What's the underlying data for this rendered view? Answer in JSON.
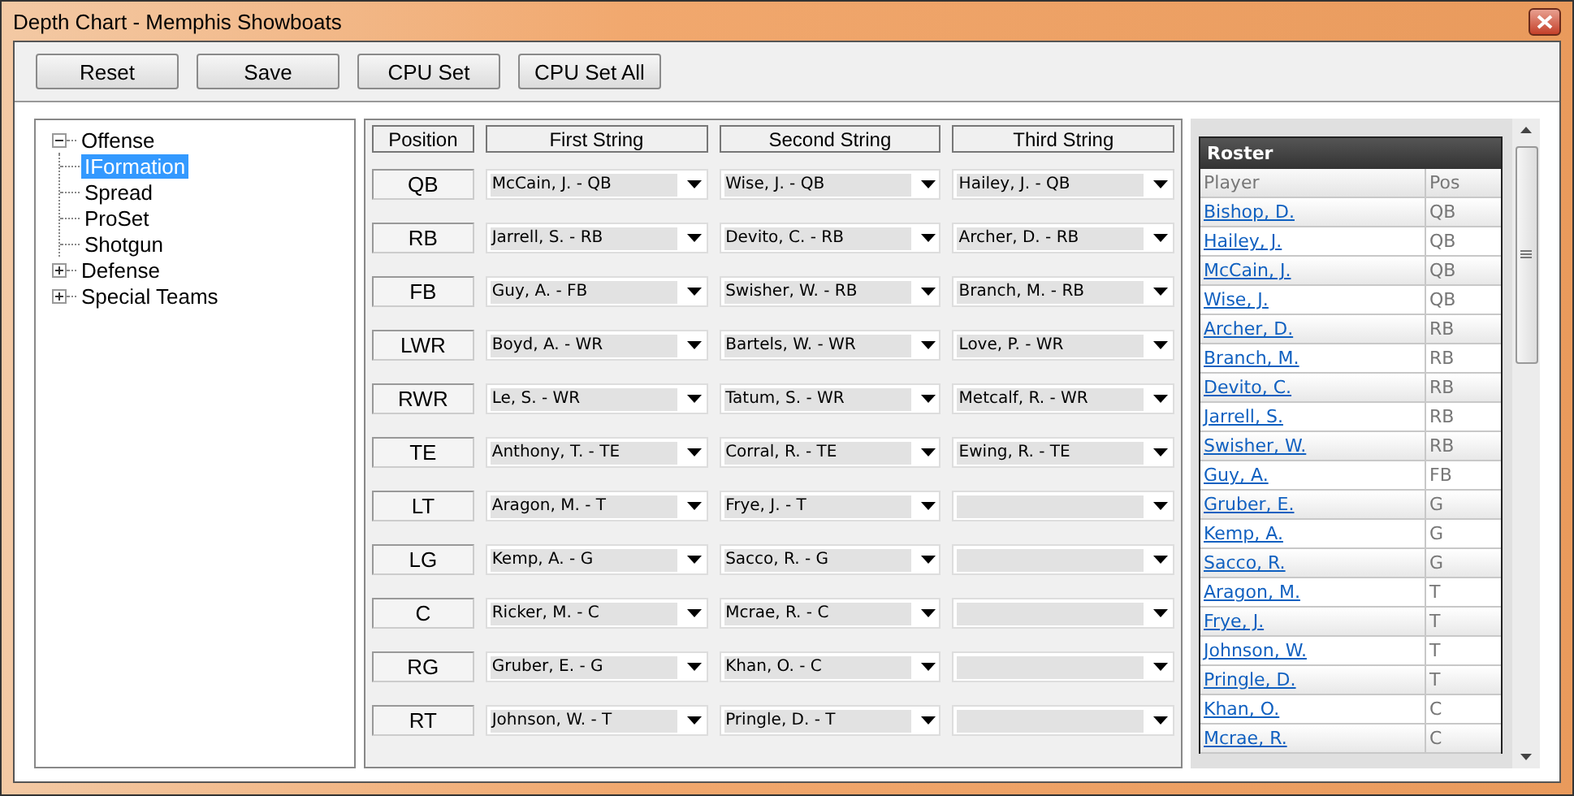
{
  "window": {
    "title": "Depth Chart - Memphis Showboats"
  },
  "toolbar": {
    "buttons": [
      "Reset",
      "Save",
      "CPU Set",
      "CPU Set All"
    ]
  },
  "tree": [
    {
      "label": "Offense",
      "expanded": true,
      "selected": false,
      "children": [
        {
          "label": "IFormation",
          "selected": true
        },
        {
          "label": "Spread",
          "selected": false
        },
        {
          "label": "ProSet",
          "selected": false
        },
        {
          "label": "Shotgun",
          "selected": false
        }
      ]
    },
    {
      "label": "Defense",
      "expanded": false,
      "selected": false
    },
    {
      "label": "Special Teams",
      "expanded": false,
      "selected": false
    }
  ],
  "depth_chart": {
    "columns": [
      "Position",
      "First String",
      "Second String",
      "Third String"
    ],
    "rows": [
      {
        "position": "QB",
        "strings": [
          "McCain, J. - QB",
          "Wise, J. - QB",
          "Hailey, J. - QB"
        ]
      },
      {
        "position": "RB",
        "strings": [
          "Jarrell, S. - RB",
          "Devito, C. - RB",
          "Archer, D. - RB"
        ]
      },
      {
        "position": "FB",
        "strings": [
          "Guy, A. - FB",
          "Swisher, W. - RB",
          "Branch, M. - RB"
        ]
      },
      {
        "position": "LWR",
        "strings": [
          "Boyd, A. - WR",
          "Bartels, W. - WR",
          "Love, P. - WR"
        ]
      },
      {
        "position": "RWR",
        "strings": [
          "Le, S. - WR",
          "Tatum, S. - WR",
          "Metcalf, R. - WR"
        ]
      },
      {
        "position": "TE",
        "strings": [
          "Anthony, T. - TE",
          "Corral, R. - TE",
          "Ewing, R. - TE"
        ]
      },
      {
        "position": "LT",
        "strings": [
          "Aragon, M. - T",
          "Frye, J. - T"
        ]
      },
      {
        "position": "LG",
        "strings": [
          "Kemp, A. - G",
          "Sacco, R. - G"
        ]
      },
      {
        "position": "C",
        "strings": [
          "Ricker, M. - C",
          "Mcrae, R. - C"
        ]
      },
      {
        "position": "RG",
        "strings": [
          "Gruber, E. - G",
          "Khan, O. - C"
        ]
      },
      {
        "position": "RT",
        "strings": [
          "Johnson, W. - T",
          "Pringle, D. - T"
        ]
      }
    ]
  },
  "roster": {
    "title": "Roster",
    "columns": [
      "Player",
      "Pos"
    ],
    "rows": [
      {
        "player": "Bishop, D.",
        "pos": "QB"
      },
      {
        "player": "Hailey, J.",
        "pos": "QB"
      },
      {
        "player": "McCain, J.",
        "pos": "QB"
      },
      {
        "player": "Wise, J.",
        "pos": "QB"
      },
      {
        "player": "Archer, D.",
        "pos": "RB"
      },
      {
        "player": "Branch, M.",
        "pos": "RB"
      },
      {
        "player": "Devito, C.",
        "pos": "RB"
      },
      {
        "player": "Jarrell, S.",
        "pos": "RB"
      },
      {
        "player": "Swisher, W.",
        "pos": "RB"
      },
      {
        "player": "Guy, A.",
        "pos": "FB"
      },
      {
        "player": "Gruber, E.",
        "pos": "G"
      },
      {
        "player": "Kemp, A.",
        "pos": "G"
      },
      {
        "player": "Sacco, R.",
        "pos": "G"
      },
      {
        "player": "Aragon, M.",
        "pos": "T"
      },
      {
        "player": "Frye, J.",
        "pos": "T"
      },
      {
        "player": "Johnson, W.",
        "pos": "T"
      },
      {
        "player": "Pringle, D.",
        "pos": "T"
      },
      {
        "player": "Khan, O.",
        "pos": "C"
      },
      {
        "player": "Mcrae, R.",
        "pos": "C"
      }
    ]
  }
}
